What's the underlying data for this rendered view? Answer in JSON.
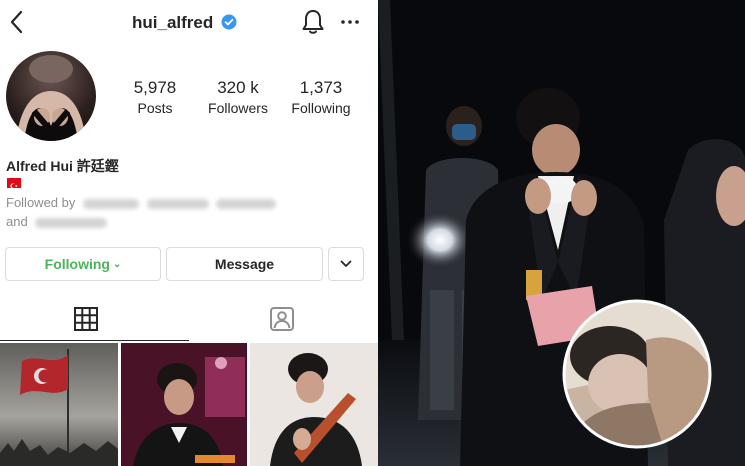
{
  "profile": {
    "username": "hui_alfred",
    "stats": [
      {
        "value": "5,978",
        "label": "Posts"
      },
      {
        "value": "320 k",
        "label": "Followers"
      },
      {
        "value": "1,373",
        "label": "Following"
      }
    ],
    "full_name": "Alfred Hui 許廷鏗",
    "followed_by_prefix": "Followed by",
    "followed_and": "and",
    "buttons": {
      "following": "Following",
      "message": "Message"
    }
  },
  "colors": {
    "following_green": "#4cb45a",
    "verified_blue": "#3897f0"
  },
  "icons": {
    "back": "chevron-left-icon",
    "verified": "verified-badge-icon",
    "bell": "bell-icon",
    "more": "more-dots-icon",
    "grid": "grid-icon",
    "tagged": "tagged-icon"
  }
}
